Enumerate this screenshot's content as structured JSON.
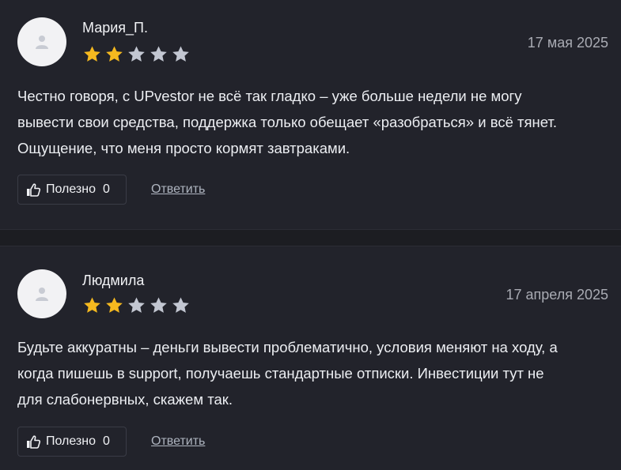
{
  "reviews": [
    {
      "author": "Мария_П.",
      "date": "17 мая 2025",
      "rating": 2,
      "max_rating": 5,
      "text_lines": [
        "Честно говоря, с UPvestor не всё так гладко – уже больше недели не могу",
        "вывести свои средства, поддержка только обещает «разобраться» и всё тянет.",
        "Ощущение, что меня просто кормят завтраками."
      ],
      "helpful_label": "Полезно",
      "helpful_count": "0",
      "reply_label": "Ответить"
    },
    {
      "author": "Людмила",
      "date": "17 апреля 2025",
      "rating": 2,
      "max_rating": 5,
      "text_lines": [
        "Будьте аккуратны – деньги вывести проблематично, условия меняют на ходу, а",
        "когда пишешь в support, получаешь стандартные отписки. Инвестиции тут не",
        "для слабонервных, скажем так."
      ],
      "helpful_label": "Полезно",
      "helpful_count": "0",
      "reply_label": "Ответить"
    }
  ],
  "colors": {
    "star_filled": "#f5b91f",
    "star_empty": "#c3c7d2",
    "background": "#22232b"
  },
  "icons": {
    "avatar": "user-silhouette-icon",
    "helpful": "thumbs-up-icon",
    "rating": "star-icon"
  }
}
